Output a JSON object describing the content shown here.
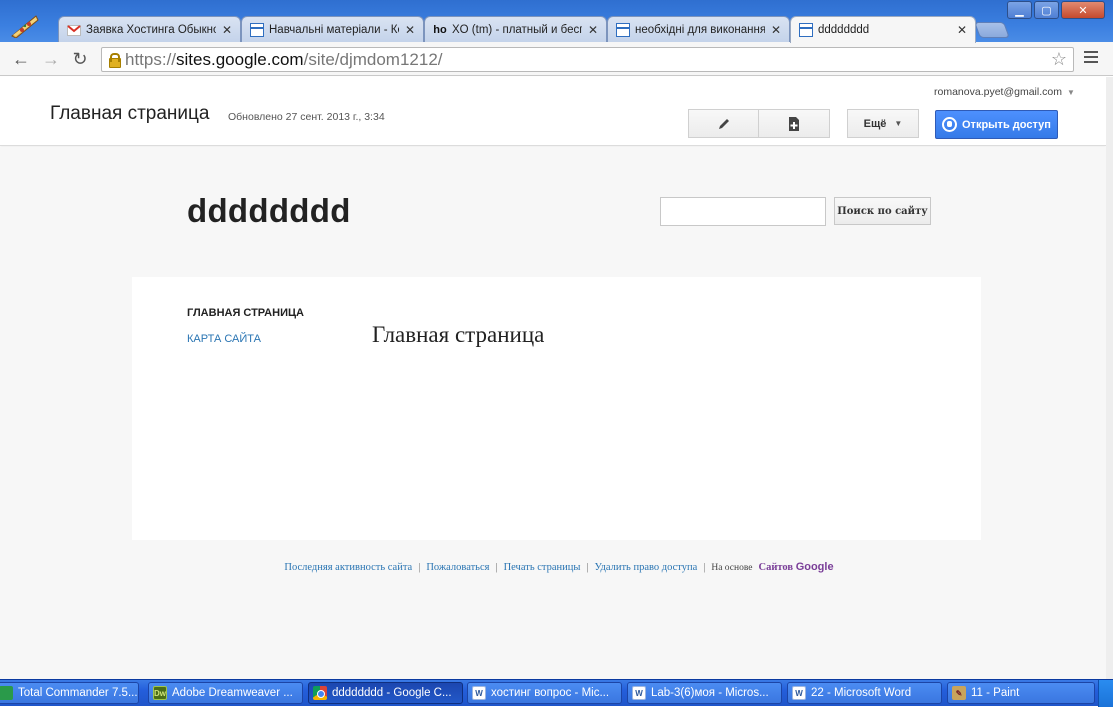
{
  "browser": {
    "tabs": [
      {
        "title": "Заявка Хостинга Обыкно",
        "icon": "gmail-icon"
      },
      {
        "title": "Навчальні матеріали - Ко",
        "icon": "sites-doc-icon"
      },
      {
        "title": "XO (tm) - платный и бесп",
        "icon": "ho-icon"
      },
      {
        "title": "необхідні для виконання",
        "icon": "sites-doc-icon"
      },
      {
        "title": "dddddddd",
        "icon": "sites-doc-icon"
      }
    ],
    "close_glyph": "✕",
    "url_proto": "https://",
    "url_host": "sites.google.com",
    "url_path": "/site/djmdom1212/",
    "window_buttons": {
      "minimize": "▁",
      "maximize": "▢",
      "close": "✕"
    }
  },
  "sites_header": {
    "page_title": "Главная страница",
    "updated": "Обновлено 27 сент. 2013 г., 3:34",
    "account": "romanova.pyet@gmail.com",
    "more_label": "Ещё",
    "share_label": "Открыть доступ"
  },
  "site": {
    "name": "dddddddd",
    "search_button": "Поиск по сайту",
    "nav": {
      "home": "ГЛАВНАЯ СТРАНИЦА",
      "sitemap": "КАРТА САЙТА"
    },
    "main_heading": "Главная страница"
  },
  "footer": {
    "links": [
      "Последняя активность сайта",
      "Пожаловаться",
      "Печать страницы",
      "Удалить право доступа"
    ],
    "based_on": "На основе",
    "brand_prefix": "Сайтов",
    "brand": "Google"
  },
  "taskbar": {
    "items": [
      {
        "label": "Total Commander 7.5...",
        "icon": "total-commander-icon"
      },
      {
        "label": "Adobe Dreamweaver ...",
        "icon": "dreamweaver-icon"
      },
      {
        "label": "dddddddd - Google C...",
        "icon": "chrome-icon"
      },
      {
        "label": "хостинг вопрос - Mic...",
        "icon": "word-icon"
      },
      {
        "label": "Lab-3(6)моя - Micros...",
        "icon": "word-icon"
      },
      {
        "label": "22 - Microsoft Word",
        "icon": "word-icon"
      },
      {
        "label": "11 - Paint",
        "icon": "paint-icon"
      }
    ]
  },
  "colors": {
    "accent_blue": "#4d90fe",
    "link": "#2a75b3",
    "brand_purple": "#7a3e98",
    "taskbar": "#245edb"
  }
}
